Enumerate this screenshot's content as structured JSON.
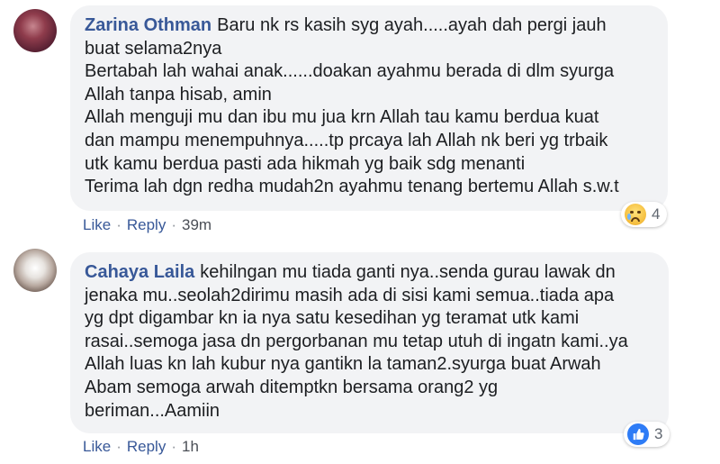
{
  "comments": [
    {
      "author": "Zarina Othman",
      "lines": [
        "Baru nk rs kasih syg ayah.....ayah dah pergi jauh",
        "buat selama2nya",
        "Bertabah lah wahai anak......doakan ayahmu berada di dlm syurga",
        "Allah tanpa hisab, amin",
        "Allah menguji mu dan ibu mu jua krn Allah tau kamu berdua kuat",
        "dan mampu menempuhnya.....tp prcaya lah Allah nk beri yg trbaik",
        "utk kamu berdua pasti ada hikmah yg baik sdg menanti",
        "Terima lah dgn redha mudah2n ayahmu tenang bertemu Allah s.w.t"
      ],
      "like_label": "Like",
      "reply_label": "Reply",
      "time": "39m",
      "reaction": {
        "icon": "sad-face-icon",
        "count": "4"
      }
    },
    {
      "author": "Cahaya Laila",
      "lines": [
        "kehilngan mu tiada ganti nya..senda gurau lawak dn",
        "jenaka mu..seolah2dirimu masih ada di sisi kami semua..tiada apa",
        "yg dpt digambar kn ia nya satu kesedihan yg teramat utk kami",
        "rasai..semoga jasa dn pergorbanan mu tetap utuh di ingatn kami..ya",
        "Allah luas kn lah kubur nya gantikn la taman2.syurga buat Arwah",
        "Abam semoga arwah ditemptkn bersama orang2 yg",
        "beriman...Aamiin"
      ],
      "like_label": "Like",
      "reply_label": "Reply",
      "time": "1h",
      "reaction": {
        "icon": "thumbs-up-icon",
        "count": "3"
      }
    }
  ],
  "separator": "·"
}
